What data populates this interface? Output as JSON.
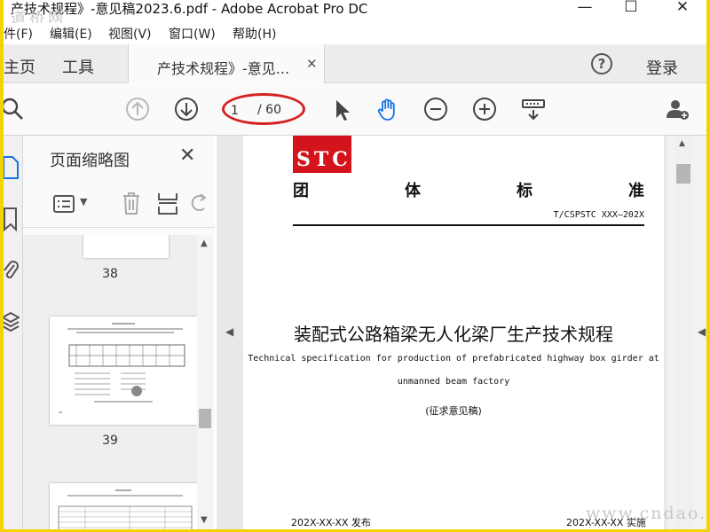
{
  "window": {
    "title": "产技术规程》-意见稿2023.6.pdf - Adobe Acrobat Pro DC",
    "watermark_top": "道桥网"
  },
  "menu": [
    "件(F)",
    "编辑(E)",
    "视图(V)",
    "窗口(W)",
    "帮助(H)"
  ],
  "tabs": {
    "home": "主页",
    "tools": "工具",
    "document": "产技术规程》-意见...",
    "login": "登录"
  },
  "toolbar": {
    "page_current": "1",
    "page_total": "/ 60"
  },
  "sidebar": {
    "title": "页面缩略图",
    "thumbnails": [
      {
        "page": "38"
      },
      {
        "page": "39"
      }
    ]
  },
  "document": {
    "logo": "STC",
    "standard_chars": [
      "团",
      "体",
      "标",
      "准"
    ],
    "standard_code": "T/CSPSTC XXX—202X",
    "title_cn": "装配式公路箱梁无人化梁厂生产技术规程",
    "title_en_line1": "Technical specification for production of prefabricated highway box girder at",
    "title_en_line2": "unmanned beam factory",
    "note": "(征求意见稿)",
    "publish_date": "202X-XX-XX 发布",
    "implement_date": "202X-XX-XX 实施"
  },
  "watermark_bottom": "www.cndao.com",
  "colors": {
    "border": "#f3d400",
    "logo_red": "#d4141c",
    "annotation_red": "#d62020",
    "accent_blue": "#1473e6"
  }
}
